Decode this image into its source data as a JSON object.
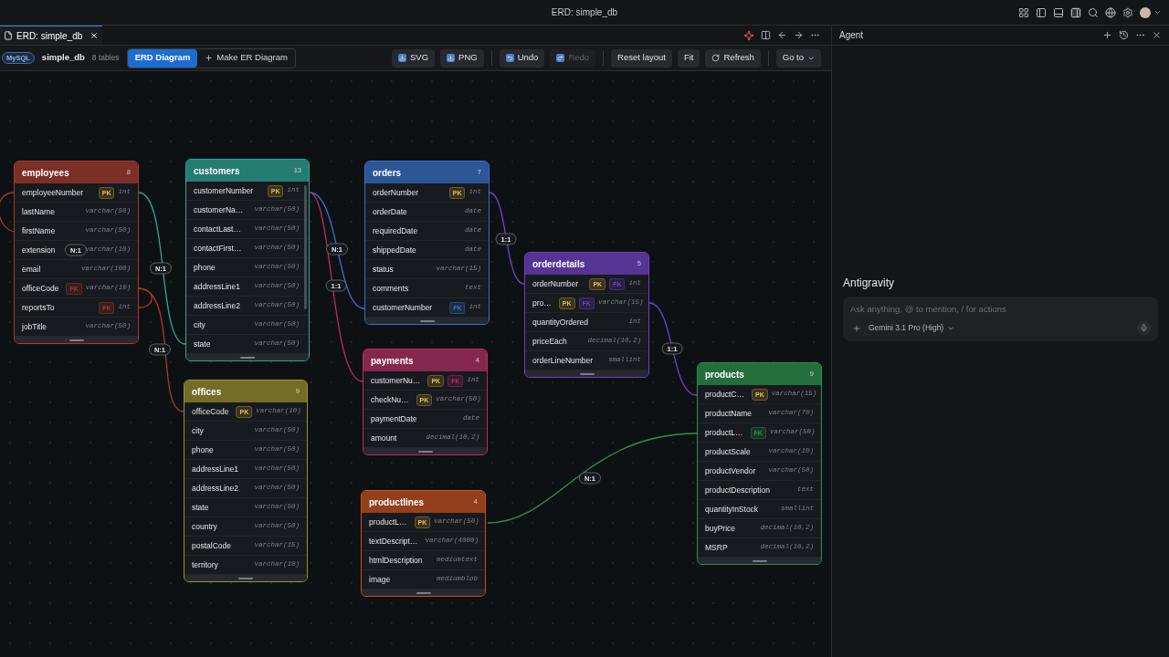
{
  "window": {
    "title": "ERD: simple_db"
  },
  "tab": {
    "label": "ERD: simple_db",
    "selected": true
  },
  "toolbar": {
    "engine": "MySQL",
    "database": "simple_db",
    "count": "8 tables",
    "views": [
      {
        "label": "ERD Diagram",
        "selected": true
      },
      {
        "label": "Make ER Diagram",
        "selected": false
      }
    ],
    "actions": [
      {
        "label": "SVG",
        "disabled": false
      },
      {
        "label": "PNG",
        "disabled": false
      },
      {
        "label": "Undo",
        "disabled": false
      },
      {
        "label": "Redo",
        "disabled": true
      },
      {
        "label": "Reset layout",
        "disabled": false
      },
      {
        "label": "Fit",
        "disabled": false
      },
      {
        "label": "Refresh",
        "disabled": false
      },
      {
        "label": "Go to",
        "disabled": false
      }
    ]
  },
  "tables": [
    {
      "name": "employees",
      "count": "8",
      "color": "#a8392c",
      "columns": [
        {
          "name": "employeeNumber",
          "type": "int",
          "keys": [
            {
              "kind": "pk",
              "text": "PK"
            }
          ]
        },
        {
          "name": "lastName",
          "type": "varchar(50)"
        },
        {
          "name": "firstName",
          "type": "varchar(50)"
        },
        {
          "name": "extension",
          "type": "varchar(10)"
        },
        {
          "name": "email",
          "type": "varchar(100)"
        },
        {
          "name": "officeCode",
          "type": "varchar(10)",
          "keys": [
            {
              "kind": "fk",
              "text": "FK"
            }
          ]
        },
        {
          "name": "reportsTo",
          "type": "int",
          "keys": [
            {
              "kind": "fk",
              "text": "FK"
            }
          ]
        },
        {
          "name": "jobTitle",
          "type": "varchar(50)"
        }
      ]
    },
    {
      "name": "customers",
      "count": "13",
      "color": "#2aa898",
      "columns": [
        {
          "name": "customerNumber",
          "type": "int",
          "keys": [
            {
              "kind": "pk",
              "text": "PK"
            }
          ]
        },
        {
          "name": "customerNa…",
          "type": "varchar(50)"
        },
        {
          "name": "contactLast…",
          "type": "varchar(50)"
        },
        {
          "name": "contactFirst…",
          "type": "varchar(50)"
        },
        {
          "name": "phone",
          "type": "varchar(50)"
        },
        {
          "name": "addressLine1",
          "type": "varchar(50)"
        },
        {
          "name": "addressLine2",
          "type": "varchar(50)"
        },
        {
          "name": "city",
          "type": "varchar(50)"
        },
        {
          "name": "state",
          "type": "varchar(50)"
        }
      ]
    },
    {
      "name": "orders",
      "count": "7",
      "color": "#3571cc",
      "columns": [
        {
          "name": "orderNumber",
          "type": "int",
          "keys": [
            {
              "kind": "pk",
              "text": "PK"
            }
          ]
        },
        {
          "name": "orderDate",
          "type": "date"
        },
        {
          "name": "requiredDate",
          "type": "date"
        },
        {
          "name": "shippedDate",
          "type": "date"
        },
        {
          "name": "status",
          "type": "varchar(15)"
        },
        {
          "name": "comments",
          "type": "text"
        },
        {
          "name": "customerNumber",
          "type": "int",
          "keys": [
            {
              "kind": "fk",
              "text": "FK"
            }
          ]
        }
      ]
    },
    {
      "name": "orderdetails",
      "count": "5",
      "color": "#7140c8",
      "columns": [
        {
          "name": "orderNumber",
          "type": "int",
          "keys": [
            {
              "kind": "pk",
              "text": "PK"
            },
            {
              "kind": "fk",
              "text": "FK"
            }
          ]
        },
        {
          "name": "pro…",
          "type": "varchar(15)",
          "keys": [
            {
              "kind": "pk",
              "text": "PK"
            },
            {
              "kind": "fk",
              "text": "FK"
            }
          ]
        },
        {
          "name": "quantityOrdered",
          "type": "int"
        },
        {
          "name": "priceEach",
          "type": "decimal(10,2)"
        },
        {
          "name": "orderLineNumber",
          "type": "smallint"
        }
      ]
    },
    {
      "name": "payments",
      "count": "4",
      "color": "#b82e62",
      "columns": [
        {
          "name": "customerNu…",
          "type": "int",
          "keys": [
            {
              "kind": "pk",
              "text": "PK"
            },
            {
              "kind": "fk",
              "text": "FK"
            }
          ]
        },
        {
          "name": "checkNu…",
          "type": "varchar(50)",
          "keys": [
            {
              "kind": "pk",
              "text": "PK"
            }
          ]
        },
        {
          "name": "paymentDate",
          "type": "date"
        },
        {
          "name": "amount",
          "type": "decimal(10,2)"
        }
      ]
    },
    {
      "name": "offices",
      "count": "9",
      "color": "#9c922f",
      "columns": [
        {
          "name": "officeCode",
          "type": "varchar(10)",
          "keys": [
            {
              "kind": "pk",
              "text": "PK"
            }
          ]
        },
        {
          "name": "city",
          "type": "varchar(50)"
        },
        {
          "name": "phone",
          "type": "varchar(50)"
        },
        {
          "name": "addressLine1",
          "type": "varchar(50)"
        },
        {
          "name": "addressLine2",
          "type": "varchar(50)"
        },
        {
          "name": "state",
          "type": "varchar(50)"
        },
        {
          "name": "country",
          "type": "varchar(50)"
        },
        {
          "name": "postalCode",
          "type": "varchar(15)"
        },
        {
          "name": "territory",
          "type": "varchar(10)"
        }
      ]
    },
    {
      "name": "productlines",
      "count": "4",
      "color": "#cc501c",
      "columns": [
        {
          "name": "productL…",
          "type": "varchar(50)",
          "keys": [
            {
              "kind": "pk",
              "text": "PK"
            }
          ]
        },
        {
          "name": "textDescript…",
          "type": "varchar(4000)"
        },
        {
          "name": "htmlDescription",
          "type": "mediumtext"
        },
        {
          "name": "image",
          "type": "mediumblob"
        }
      ]
    },
    {
      "name": "products",
      "count": "9",
      "color": "#2a9448",
      "columns": [
        {
          "name": "productC…",
          "type": "varchar(15)",
          "keys": [
            {
              "kind": "pk",
              "text": "PK"
            }
          ]
        },
        {
          "name": "productName",
          "type": "varchar(70)"
        },
        {
          "name": "productL…",
          "type": "varchar(50)",
          "keys": [
            {
              "kind": "fk",
              "text": "FK"
            }
          ]
        },
        {
          "name": "productScale",
          "type": "varchar(10)"
        },
        {
          "name": "productVendor",
          "type": "varchar(50)"
        },
        {
          "name": "productDescription",
          "type": "text"
        },
        {
          "name": "quantityInStock",
          "type": "smallint"
        },
        {
          "name": "buyPrice",
          "type": "decimal(10,2)"
        },
        {
          "name": "MSRP",
          "type": "decimal(10,2)"
        }
      ]
    }
  ],
  "relationships": [
    {
      "label": "N:1"
    },
    {
      "label": "N:1"
    },
    {
      "label": "N:1"
    },
    {
      "label": "N:1"
    },
    {
      "label": "1:1"
    },
    {
      "label": "1:1"
    },
    {
      "label": "1:1"
    },
    {
      "label": "N:1"
    }
  ],
  "agent": {
    "title": "Agent",
    "heading": "Antigravity",
    "placeholder": "Ask anything, @ to mention, / for actions",
    "model": "Gemini 3.1 Pro (High)"
  }
}
